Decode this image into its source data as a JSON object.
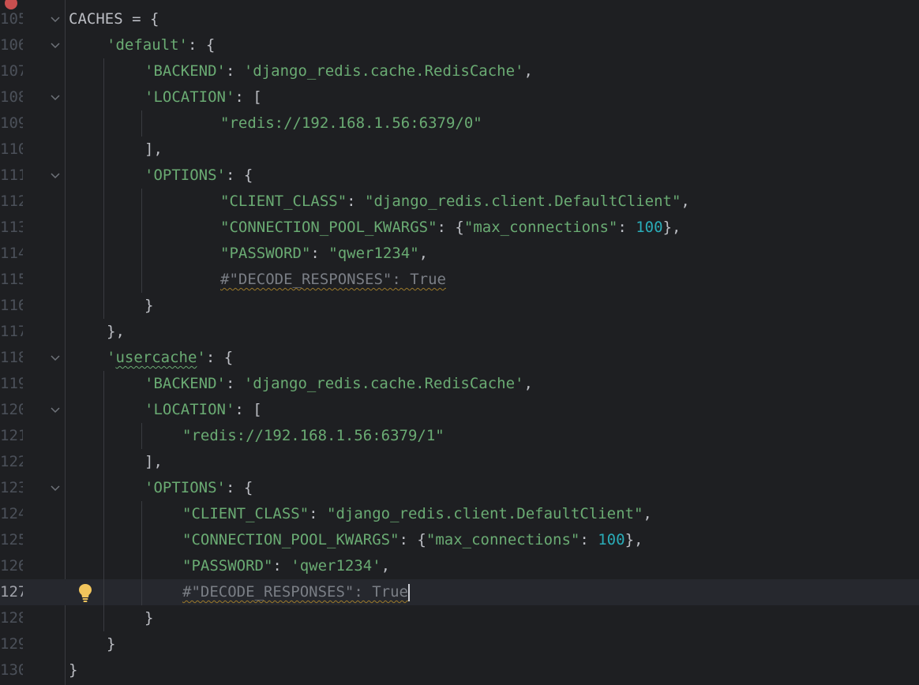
{
  "colors": {
    "background": "#1e1f22",
    "current_line": "#26282e",
    "string": "#6aab73",
    "number": "#2aacb8",
    "comment": "#7a7e85",
    "text": "#bcbec4",
    "line_number": "#4b5059",
    "warning_underline": "#9c7a2a",
    "bulb": "#f2c55c",
    "error_marker": "#c94f4f"
  },
  "icons": {
    "fold": "chevron-down-icon",
    "intention": "lightbulb-icon",
    "error": "error-marker-icon"
  },
  "current_line": 127,
  "lines": [
    {
      "num": "105",
      "t": [
        "CACHES = {"
      ]
    },
    {
      "num": "106",
      "t": [
        "'default'",
        ": {"
      ]
    },
    {
      "num": "107",
      "t": [
        "'BACKEND'",
        ": ",
        "'django_redis.cache.RedisCache'",
        ","
      ]
    },
    {
      "num": "108",
      "t": [
        "'LOCATION'",
        ": ["
      ]
    },
    {
      "num": "109",
      "t": [
        "\"redis://192.168.1.56:6379/0\""
      ]
    },
    {
      "num": "110",
      "t": [
        "],"
      ]
    },
    {
      "num": "111",
      "t": [
        "'OPTIONS'",
        ": {"
      ]
    },
    {
      "num": "112",
      "t": [
        "\"CLIENT_CLASS\"",
        ": ",
        "\"django_redis.client.DefaultClient\"",
        ","
      ]
    },
    {
      "num": "113",
      "t": [
        "\"CONNECTION_POOL_KWARGS\"",
        ": {",
        "\"max_connections\"",
        ": ",
        "100",
        "},"
      ]
    },
    {
      "num": "114",
      "t": [
        "\"PASSWORD\"",
        ": ",
        "\"qwer1234\"",
        ","
      ]
    },
    {
      "num": "115",
      "t": [
        "#\"DECODE_RESPONSES\": True"
      ]
    },
    {
      "num": "116",
      "t": [
        "}"
      ]
    },
    {
      "num": "117",
      "t": [
        "},"
      ]
    },
    {
      "num": "118",
      "t": [
        "'",
        "usercache",
        "'",
        ": {"
      ]
    },
    {
      "num": "119",
      "t": [
        "'BACKEND'",
        ": ",
        "'django_redis.cache.RedisCache'",
        ","
      ]
    },
    {
      "num": "120",
      "t": [
        "'LOCATION'",
        ": ["
      ]
    },
    {
      "num": "121",
      "t": [
        "\"redis://192.168.1.56:6379/1\""
      ]
    },
    {
      "num": "122",
      "t": [
        "],"
      ]
    },
    {
      "num": "123",
      "t": [
        "'OPTIONS'",
        ": {"
      ]
    },
    {
      "num": "124",
      "t": [
        "\"CLIENT_CLASS\"",
        ": ",
        "\"django_redis.client.DefaultClient\"",
        ","
      ]
    },
    {
      "num": "125",
      "t": [
        "\"CONNECTION_POOL_KWARGS\"",
        ": {",
        "\"max_connections\"",
        ": ",
        "100",
        "},"
      ]
    },
    {
      "num": "126",
      "t": [
        "\"PASSWORD\"",
        ": ",
        "'qwer1234'",
        ","
      ]
    },
    {
      "num": "127",
      "t": [
        "#\"DECODE_RESPONSES\": True"
      ]
    },
    {
      "num": "128",
      "t": [
        "}"
      ]
    },
    {
      "num": "129",
      "t": [
        "}"
      ]
    },
    {
      "num": "130",
      "t": [
        "}"
      ]
    }
  ]
}
